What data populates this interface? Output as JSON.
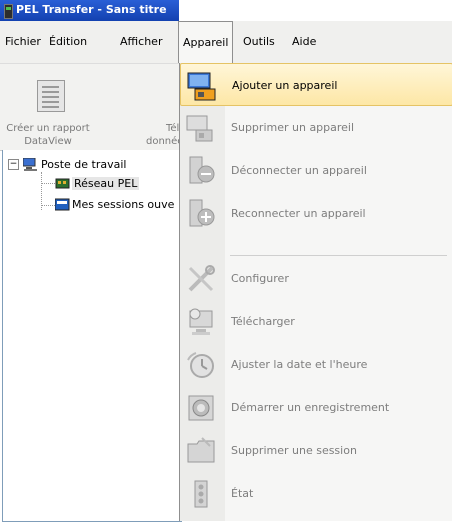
{
  "window": {
    "title": "PEL Transfer - Sans titre"
  },
  "menubar": {
    "items": [
      {
        "label": "Fichier"
      },
      {
        "label": "Édition"
      },
      {
        "label": "Afficher"
      },
      {
        "label": "Appareil"
      },
      {
        "label": "Outils"
      },
      {
        "label": "Aide"
      }
    ]
  },
  "toolbar": {
    "create_report": {
      "line1": "Créer un rapport",
      "line2": "DataView"
    },
    "download": {
      "line1": "Télé",
      "line2": "données"
    }
  },
  "tree": {
    "root": "Poste de travail",
    "children": [
      {
        "label": "Réseau PEL"
      },
      {
        "label": "Mes sessions ouve"
      }
    ],
    "expander": "−"
  },
  "device_menu": {
    "items": [
      {
        "label": "Ajouter un appareil",
        "icon": "add-device-icon",
        "enabled": true
      },
      {
        "label": "Supprimer un appareil",
        "icon": "remove-device-icon",
        "enabled": false
      },
      {
        "label": "Déconnecter un appareil",
        "icon": "disconnect-device-icon",
        "enabled": false
      },
      {
        "label": "Reconnecter un appareil",
        "icon": "reconnect-device-icon",
        "enabled": false
      },
      {
        "label": "Configurer",
        "icon": "configure-tools-icon",
        "enabled": false
      },
      {
        "label": "Télécharger",
        "icon": "download-monitor-icon",
        "enabled": false
      },
      {
        "label": "Ajuster la date et l'heure",
        "icon": "clock-adjust-icon",
        "enabled": false
      },
      {
        "label": "Démarrer un enregistrement",
        "icon": "record-start-icon",
        "enabled": false
      },
      {
        "label": "Supprimer une session",
        "icon": "delete-session-folder-icon",
        "enabled": false
      },
      {
        "label": "État",
        "icon": "status-icon",
        "enabled": false
      }
    ]
  }
}
